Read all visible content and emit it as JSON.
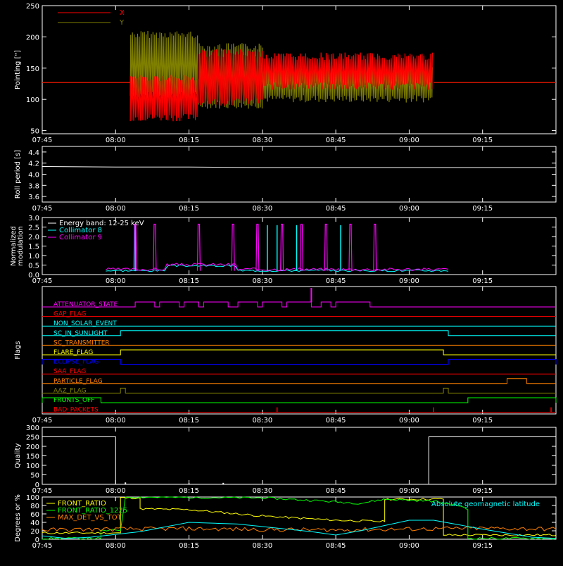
{
  "time_ticks": [
    "07:45",
    "08:00",
    "08:15",
    "08:30",
    "08:45",
    "09:00",
    "09:15"
  ],
  "chart_data": [
    {
      "id": "pointing",
      "type": "line",
      "ylabel": "Pointing [\"]",
      "ylim": [
        45,
        250
      ],
      "yticks": [
        50,
        100,
        150,
        200,
        250
      ],
      "legend": {
        "placement": "top-left",
        "entries": [
          {
            "name": "X",
            "color": "#ff0000"
          },
          {
            "name": "Y",
            "color": "#808000"
          }
        ]
      },
      "series": [
        {
          "name": "X",
          "color": "#ff0000",
          "segments": [
            {
              "t": [
                "07:45",
                "08:03"
              ],
              "y": 127
            },
            {
              "t": [
                "08:03",
                "08:17"
              ],
              "band": [
                65,
                140
              ]
            },
            {
              "t": [
                "08:17",
                "08:30"
              ],
              "band": [
                90,
                180
              ]
            },
            {
              "t": [
                "08:30",
                "09:05"
              ],
              "band": [
                115,
                175
              ]
            },
            {
              "t": [
                "09:05",
                "09:30"
              ],
              "y": 127
            }
          ]
        },
        {
          "name": "Y",
          "color": "#808000",
          "segments": [
            {
              "t": [
                "07:45",
                "08:03"
              ],
              "y": 127
            },
            {
              "t": [
                "08:03",
                "08:17"
              ],
              "band": [
                100,
                210
              ]
            },
            {
              "t": [
                "08:17",
                "08:30"
              ],
              "band": [
                85,
                190
              ]
            },
            {
              "t": [
                "08:30",
                "09:05"
              ],
              "band": [
                95,
                160
              ]
            },
            {
              "t": [
                "09:05",
                "09:30"
              ],
              "y": 127
            }
          ]
        }
      ]
    },
    {
      "id": "roll",
      "type": "line",
      "ylabel": "Roll period [s]",
      "ylim": [
        3.5,
        4.5
      ],
      "yticks": [
        "3.6",
        "3.8",
        "4.0",
        "4.2",
        "4.4"
      ],
      "series": [
        {
          "name": "",
          "color": "#ffffff",
          "points": [
            [
              "07:45",
              4.14
            ],
            [
              "08:00",
              4.13
            ],
            [
              "08:15",
              4.13
            ],
            [
              "08:30",
              4.12
            ],
            [
              "08:45",
              4.12
            ],
            [
              "09:00",
              4.12
            ],
            [
              "09:30",
              4.12
            ]
          ]
        }
      ]
    },
    {
      "id": "modulation",
      "type": "line",
      "ylabel": "Normalized modulation",
      "ylim": [
        0,
        3.0
      ],
      "yticks": [
        "0.0",
        "0.5",
        "1.0",
        "1.5",
        "2.0",
        "2.5",
        "3.0"
      ],
      "legend": {
        "placement": "top-left",
        "entries": [
          {
            "name": "Energy band: 12-25 keV",
            "color": "#ffffff"
          },
          {
            "name": "Collimator 8",
            "color": "#00ffff"
          },
          {
            "name": "Collimator 9",
            "color": "#ff00ff"
          }
        ]
      },
      "spikes_c9": [
        "08:04",
        "08:08",
        "08:17",
        "08:24",
        "08:29",
        "08:34",
        "08:38",
        "08:43",
        "08:48",
        "08:53"
      ],
      "spikes_c8": [
        "08:04",
        "08:31",
        "08:33",
        "08:37",
        "08:46"
      ],
      "baseline_range": [
        "07:58",
        "09:08"
      ],
      "baseline_level": 0.2
    },
    {
      "id": "flags",
      "type": "table",
      "ylabel": "Flags",
      "flags": [
        {
          "name": "ATTENUATOR_STATE",
          "color": "#ff00ff"
        },
        {
          "name": "GAP_FLAG",
          "color": "#ff0000"
        },
        {
          "name": "NON_SOLAR_EVENT",
          "color": "#00ffff"
        },
        {
          "name": "SC_IN_SUNLIGHT",
          "color": "#00ffff"
        },
        {
          "name": "SC_TRANSMITTER",
          "color": "#ff8000"
        },
        {
          "name": "FLARE_FLAG",
          "color": "#ffff00"
        },
        {
          "name": "ECLIPSE_FLAG",
          "color": "#0000ff"
        },
        {
          "name": "SAA_FLAG",
          "color": "#ff0000"
        },
        {
          "name": "PARTICLE_FLAG",
          "color": "#ff8000"
        },
        {
          "name": "AAZ_FLAG",
          "color": "#808000"
        },
        {
          "name": "FRONTS_OFF",
          "color": "#00ff00"
        },
        {
          "name": "BAD_PACKETS",
          "color": "#ff0000"
        }
      ],
      "on_intervals": {
        "ATTENUATOR_STATE": [
          [
            "08:04",
            "08:08"
          ],
          [
            "08:09",
            "08:13"
          ],
          [
            "08:14",
            "08:17"
          ],
          [
            "08:18",
            "08:23"
          ],
          [
            "08:25",
            "08:29"
          ],
          [
            "08:30",
            "08:34"
          ],
          [
            "08:35",
            "08:40"
          ],
          [
            "08:42",
            "08:44"
          ],
          [
            "08:45",
            "08:52"
          ]
        ],
        "SC_IN_SUNLIGHT": [
          [
            "08:01",
            "09:08"
          ]
        ],
        "FLARE_FLAG": [
          [
            "08:01",
            "09:07"
          ]
        ],
        "ECLIPSE_FLAG": [
          [
            "07:45",
            "08:01"
          ],
          [
            "09:08",
            "09:30"
          ]
        ],
        "PARTICLE_FLAG": [
          [
            "09:20",
            "09:24"
          ]
        ],
        "AAZ_FLAG": [
          [
            "08:01",
            "08:02"
          ],
          [
            "09:07",
            "09:08"
          ]
        ],
        "FRONTS_OFF": [
          [
            "07:45",
            "07:57"
          ],
          [
            "09:12",
            "09:30"
          ]
        ]
      },
      "bad_packets": [
        "08:33",
        "09:05",
        "09:29"
      ],
      "attenuator_spike": "08:40"
    },
    {
      "id": "quality",
      "type": "line",
      "ylabel": "Quality",
      "ylim": [
        0,
        300
      ],
      "yticks": [
        0,
        50,
        100,
        150,
        200,
        250,
        300
      ],
      "series": [
        {
          "name": "",
          "color": "#ffffff",
          "points": [
            [
              "07:45",
              250
            ],
            [
              "08:00",
              250
            ],
            [
              "08:00",
              0
            ],
            [
              "09:04",
              0
            ],
            [
              "09:04",
              250
            ],
            [
              "09:30",
              250
            ]
          ]
        }
      ]
    },
    {
      "id": "geo",
      "type": "line",
      "ylabel": "Degrees or %",
      "ylim": [
        0,
        100
      ],
      "yticks": [
        0,
        20,
        40,
        60,
        80,
        100
      ],
      "legend": {
        "placement": "top-left",
        "entries": [
          {
            "name": "FRONT_RATIO",
            "color": "#ffff00"
          },
          {
            "name": "FRONT_RATIO_1225",
            "color": "#00ff00"
          },
          {
            "name": "MAX_DET_VS_TOT",
            "color": "#ff8000"
          }
        ]
      },
      "annotation": {
        "text": "Absolute geomagnetic latitude",
        "color": "#00ffff",
        "placement": "top-right"
      },
      "series": [
        {
          "name": "FRONT_RATIO",
          "color": "#ffff00",
          "points": [
            [
              "07:45",
              15
            ],
            [
              "08:01",
              15
            ],
            [
              "08:01",
              98
            ],
            [
              "08:05",
              98
            ],
            [
              "08:05",
              72
            ],
            [
              "08:15",
              70
            ],
            [
              "08:30",
              55
            ],
            [
              "08:45",
              45
            ],
            [
              "08:55",
              42
            ],
            [
              "08:55",
              95
            ],
            [
              "09:07",
              95
            ],
            [
              "09:07",
              10
            ],
            [
              "09:30",
              10
            ]
          ]
        },
        {
          "name": "FRONT_RATIO_1225",
          "color": "#00ff00",
          "points": [
            [
              "07:45",
              2
            ],
            [
              "07:57",
              2
            ],
            [
              "07:57",
              20
            ],
            [
              "08:01",
              22
            ],
            [
              "08:02",
              100
            ],
            [
              "08:30",
              98
            ],
            [
              "08:40",
              92
            ],
            [
              "08:50",
              85
            ],
            [
              "08:55",
              95
            ],
            [
              "09:05",
              90
            ],
            [
              "09:10",
              80
            ],
            [
              "09:12",
              70
            ],
            [
              "09:12",
              2
            ],
            [
              "09:30",
              2
            ]
          ]
        },
        {
          "name": "MAX_DET_VS_TOT",
          "color": "#ff8000",
          "points": [
            [
              "07:45",
              22
            ],
            [
              "08:00",
              24
            ],
            [
              "08:15",
              25
            ],
            [
              "08:30",
              23
            ],
            [
              "08:45",
              22
            ],
            [
              "09:00",
              24
            ],
            [
              "09:15",
              26
            ],
            [
              "09:30",
              24
            ]
          ]
        },
        {
          "name": "",
          "color": "#00ffff",
          "points": [
            [
              "07:45",
              8
            ],
            [
              "07:50",
              2
            ],
            [
              "07:55",
              5
            ],
            [
              "08:05",
              18
            ],
            [
              "08:15",
              40
            ],
            [
              "08:25",
              36
            ],
            [
              "08:40",
              18
            ],
            [
              "08:45",
              10
            ],
            [
              "08:50",
              20
            ],
            [
              "09:00",
              45
            ],
            [
              "09:05",
              45
            ],
            [
              "09:15",
              24
            ],
            [
              "09:25",
              5
            ],
            [
              "09:30",
              2
            ]
          ]
        }
      ]
    }
  ]
}
